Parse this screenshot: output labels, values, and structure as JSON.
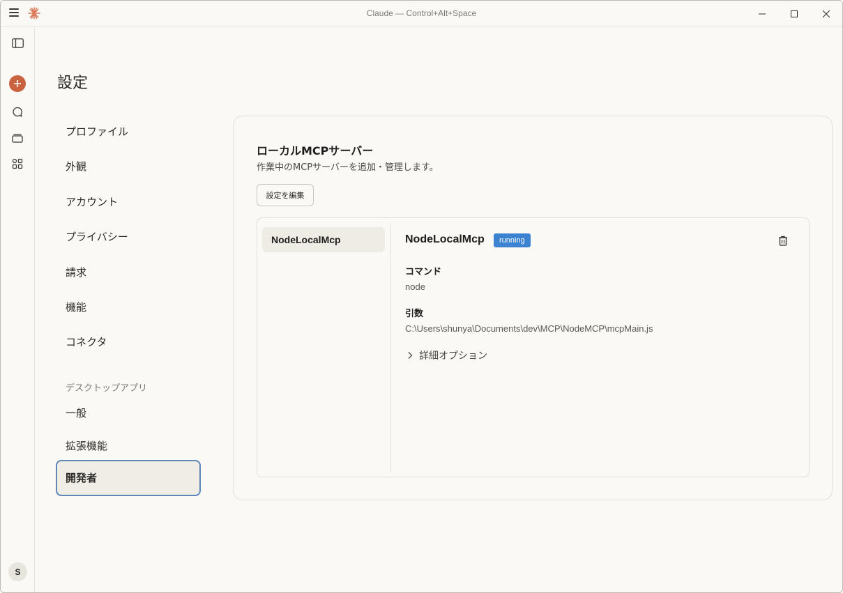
{
  "window": {
    "title": "Claude — Control+Alt+Space"
  },
  "rail": {
    "avatar_initial": "S",
    "icons": [
      "sidebar-toggle-icon",
      "plus-icon",
      "chat-bubble-icon",
      "projects-icon",
      "artifacts-icon"
    ]
  },
  "page": {
    "title": "設定"
  },
  "nav": {
    "items": [
      {
        "label": "プロファイル"
      },
      {
        "label": "外観"
      },
      {
        "label": "アカウント"
      },
      {
        "label": "プライバシー"
      },
      {
        "label": "請求"
      },
      {
        "label": "機能"
      },
      {
        "label": "コネクタ"
      }
    ],
    "section_label": "デスクトップアプリ",
    "desktop_items": [
      {
        "label": "一般"
      },
      {
        "label": "拡張機能"
      },
      {
        "label": "開発者",
        "active": true
      }
    ]
  },
  "mcp": {
    "title": "ローカルMCPサーバー",
    "subtitle": "作業中のMCPサーバーを追加・管理します。",
    "edit_button": "設定を編集",
    "servers": [
      {
        "name": "NodeLocalMcp"
      }
    ],
    "selected": {
      "name": "NodeLocalMcp",
      "status": "running",
      "command_label": "コマンド",
      "command_value": "node",
      "args_label": "引数",
      "args_value": "C:\\Users\\shunya\\Documents\\dev\\MCP\\NodeMCP\\mcpMain.js",
      "advanced_label": "詳細オプション"
    }
  },
  "colors": {
    "background": "#faf9f5",
    "accent": "#c9623f",
    "status_running": "#3b82d1",
    "active_border": "#5c87b8"
  }
}
